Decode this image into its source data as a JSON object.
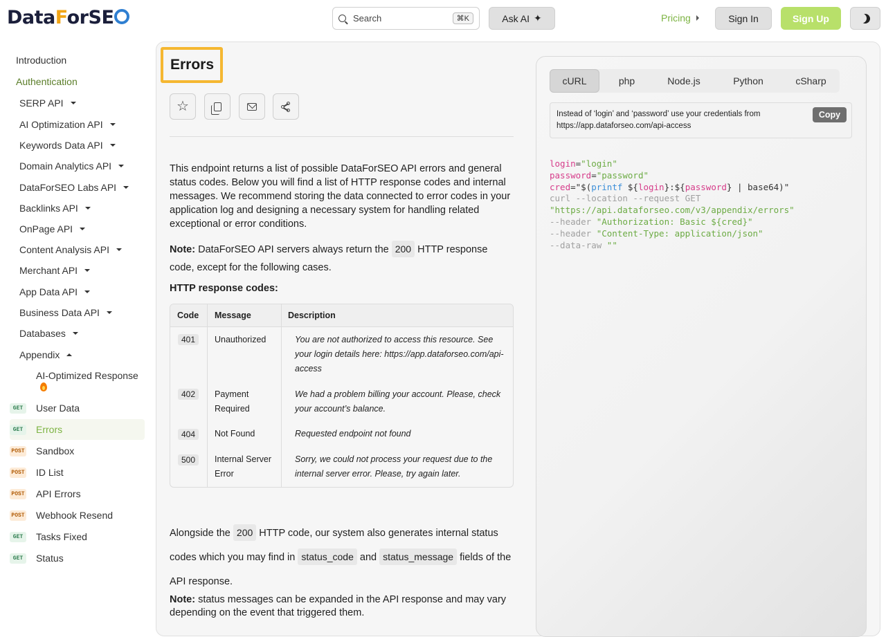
{
  "header": {
    "logo_part1": "Data",
    "logo_part2": "F",
    "logo_part3": "or",
    "logo_part4": "SE",
    "search_placeholder": "Search",
    "search_shortcut": "⌘K",
    "ask_ai_label": "Ask AI",
    "pricing_label": "Pricing",
    "signin_label": "Sign In",
    "signup_label": "Sign Up"
  },
  "sidebar": {
    "top_items": [
      "Introduction",
      "Authentication"
    ],
    "api_items": [
      "SERP API",
      "AI Optimization API",
      "Keywords Data API",
      "Domain Analytics API",
      "DataForSEO Labs API",
      "Backlinks API",
      "OnPage API",
      "Content Analysis API",
      "Merchant API",
      "App Data API",
      "Business Data API",
      "Databases",
      "Appendix"
    ],
    "sub_item": "AI-Optimized Response",
    "endpoints": [
      {
        "method": "GET",
        "label": "User Data"
      },
      {
        "method": "GET",
        "label": "Errors"
      },
      {
        "method": "POST",
        "label": "Sandbox"
      },
      {
        "method": "POST",
        "label": "ID List"
      },
      {
        "method": "POST",
        "label": "API Errors"
      },
      {
        "method": "POST",
        "label": "Webhook Resend"
      },
      {
        "method": "GET",
        "label": "Tasks Fixed"
      },
      {
        "method": "GET",
        "label": "Status"
      }
    ]
  },
  "main": {
    "title": "Errors",
    "intro": "This endpoint returns a list of possible DataForSEO API errors and general status codes. Below you will find a list of HTTP response codes and internal messages. We recommend storing the data connected to error codes in your application log and designing a necessary system for handling related exceptional or error conditions.",
    "note1_label": "Note:",
    "note1_pre": " DataForSEO API servers always return the ",
    "note1_code": "200",
    "note1_post": " HTTP response code, except for the following cases.",
    "codes_heading": "HTTP response codes:",
    "table": {
      "headers": [
        "Code",
        "Message",
        "Description"
      ],
      "rows": [
        {
          "code": "401",
          "message": "Unauthorized",
          "description": "You are not authorized to access this resource. See your login details here: https://app.dataforseo.com/api-access"
        },
        {
          "code": "402",
          "message": "Payment Required",
          "description": "We had a problem billing your account. Please, check your account’s balance."
        },
        {
          "code": "404",
          "message": "Not Found",
          "description": "Requested endpoint not found"
        },
        {
          "code": "500",
          "message": "Internal Server Error",
          "description": "Sorry, we could not process your request due to the internal server error. Please, try again later."
        }
      ]
    },
    "along_pre": "Alongside the ",
    "along_code": "200",
    "along_mid": " HTTP code, our system also generates internal status codes which you may find in ",
    "along_field1": "status_code",
    "along_and": " and ",
    "along_field2": "status_message",
    "along_post": " fields of the API response.",
    "note2_label": "Note:",
    "note2_text": " status messages can be expanded in the API response and may vary depending on the event that triggered them."
  },
  "code_panel": {
    "tabs": [
      "cURL",
      "php",
      "Node.js",
      "Python",
      "cSharp"
    ],
    "active_tab": "cURL",
    "cred_note": "Instead of ‘login’ and ‘password’ use your credentials from https://app.dataforseo.com/api-access",
    "copy_label": "Copy",
    "l1_var": "login",
    "l1_val": "\"login\"",
    "l2_var": "password",
    "l2_val": "\"password\"",
    "l3_var": "cred",
    "l3_a": "\"$(",
    "l3_fn": "printf",
    "l3_b": " ${",
    "l3_v1": "login",
    "l3_c": "}:${",
    "l3_v2": "password",
    "l3_d": "} | base64)\"",
    "l4": "curl --location --request GET",
    "l5": "\"https://api.dataforseo.com/v3/appendix/errors\"",
    "l6_a": "--header ",
    "l6_b": "\"Authorization: Basic ${cred}\"",
    "l7_a": "--header ",
    "l7_b": "\"Content-Type: application/json\"",
    "l8_a": "--data-raw ",
    "l8_b": "\"\""
  },
  "colors": {
    "accent_green": "#7cb342",
    "signup_bg": "#b8e06a",
    "title_highlight": "#f5b731"
  }
}
